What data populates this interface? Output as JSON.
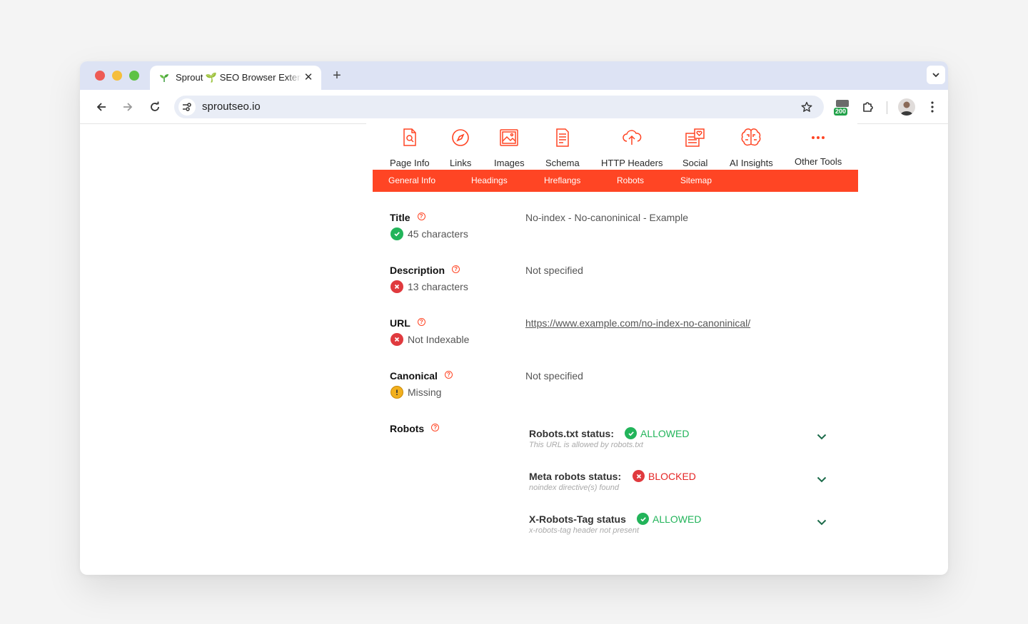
{
  "browser": {
    "tab": {
      "title": "Sprout 🌱 SEO Browser Extension",
      "close": "✕"
    },
    "new_tab": "+",
    "url": "sproutseo.io",
    "ext_badge": "200"
  },
  "nav": {
    "items": [
      {
        "label": "Page Info",
        "icon": "page-search-icon"
      },
      {
        "label": "Links",
        "icon": "compass-icon"
      },
      {
        "label": "Images",
        "icon": "images-icon"
      },
      {
        "label": "Schema",
        "icon": "schema-doc-icon"
      },
      {
        "label": "HTTP Headers",
        "icon": "cloud-icon"
      },
      {
        "label": "Social",
        "icon": "social-icon"
      },
      {
        "label": "AI Insights",
        "icon": "brain-icon"
      },
      {
        "label": "Other Tools",
        "icon": "more-dots-icon"
      }
    ],
    "accent": "#ff4524"
  },
  "subnav": {
    "items": [
      "General Info",
      "Headings",
      "Hreflangs",
      "Robots",
      "Sitemap"
    ]
  },
  "info": {
    "title": {
      "label": "Title",
      "status": "45 characters",
      "state": "ok",
      "value": "No-index - No-canoninical - Example"
    },
    "description": {
      "label": "Description",
      "status": "13 characters",
      "state": "error",
      "value": "Not specified"
    },
    "url": {
      "label": "URL",
      "status": "Not Indexable",
      "state": "error",
      "value": "https://www.example.com/no-index-no-canoninical/"
    },
    "canonical": {
      "label": "Canonical",
      "status": "Missing",
      "state": "warning",
      "value": "Not specified"
    },
    "robots": {
      "label": "Robots"
    }
  },
  "robots": [
    {
      "label": "Robots.txt status:",
      "status": "ALLOWED",
      "state": "ok",
      "sub": "This URL is allowed by robots.txt"
    },
    {
      "label": "Meta robots status:",
      "status": "BLOCKED",
      "state": "error",
      "sub": "noindex directive(s) found"
    },
    {
      "label": "X-Robots-Tag status",
      "status": "ALLOWED",
      "state": "ok",
      "sub": "x-robots-tag header not present"
    }
  ],
  "colors": {
    "ok": "#22b45a",
    "error": "#e52525",
    "warning": "#f2b01e"
  }
}
